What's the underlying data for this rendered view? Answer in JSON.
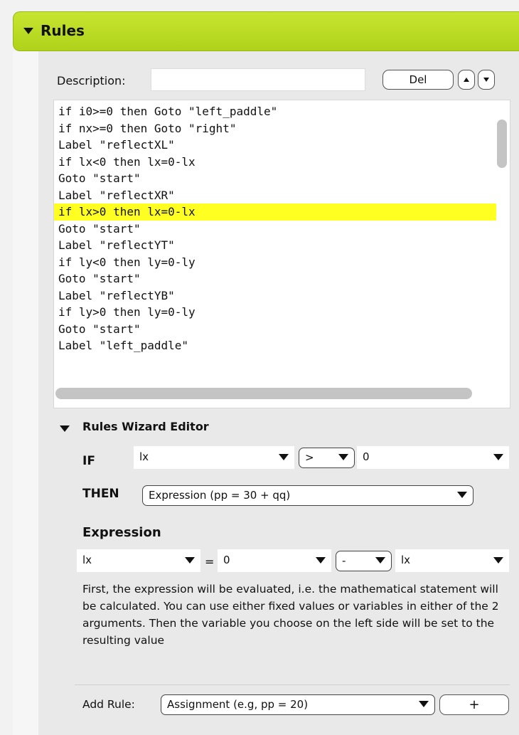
{
  "rules_panel": {
    "title": "Rules"
  },
  "description": {
    "label": "Description:",
    "value": ""
  },
  "buttons": {
    "delete": "Del",
    "move_up_icon": "arrow-up",
    "move_down_icon": "arrow-down"
  },
  "code": {
    "lines": [
      "if i0>=0 then Goto \"left_paddle\"",
      "if nx>=0 then Goto \"right\"",
      "Label \"reflectXL\"",
      "if lx<0 then lx=0-lx",
      "Goto \"start\"",
      "Label \"reflectXR\"",
      "if lx>0 then lx=0-lx",
      "Goto \"start\"",
      "Label \"reflectYT\"",
      "if ly<0 then ly=0-ly",
      "Goto \"start\"",
      "Label \"reflectYB\"",
      "if ly>0 then ly=0-ly",
      "Goto \"start\"",
      "Label \"left_paddle\""
    ],
    "highlighted_line_index": 6,
    "highlight_color": "#ffff22"
  },
  "wizard": {
    "title": "Rules Wizard Editor",
    "if_label": "IF",
    "if_variable": "lx",
    "if_operator": ">",
    "if_value": "0",
    "then_label": "THEN",
    "then_action": "Expression (pp = 30 + qq)",
    "expression_label": "Expression",
    "expr_target": "lx",
    "expr_equals": "=",
    "expr_left": "0",
    "expr_operator": "-",
    "expr_right": "lx",
    "help_text": "First, the expression will be evaluated, i.e. the mathematical statement will be calculated. You can use either fixed values or variables in either of the 2 arguments. Then the variable you choose on the left side will be set to the resulting value"
  },
  "add_rule": {
    "label": "Add Rule:",
    "selected": "Assignment (e.g, pp = 20)",
    "add_button": "+"
  },
  "colors": {
    "header_green": "#b8d820",
    "panel_bg": "#e9e9e9"
  }
}
